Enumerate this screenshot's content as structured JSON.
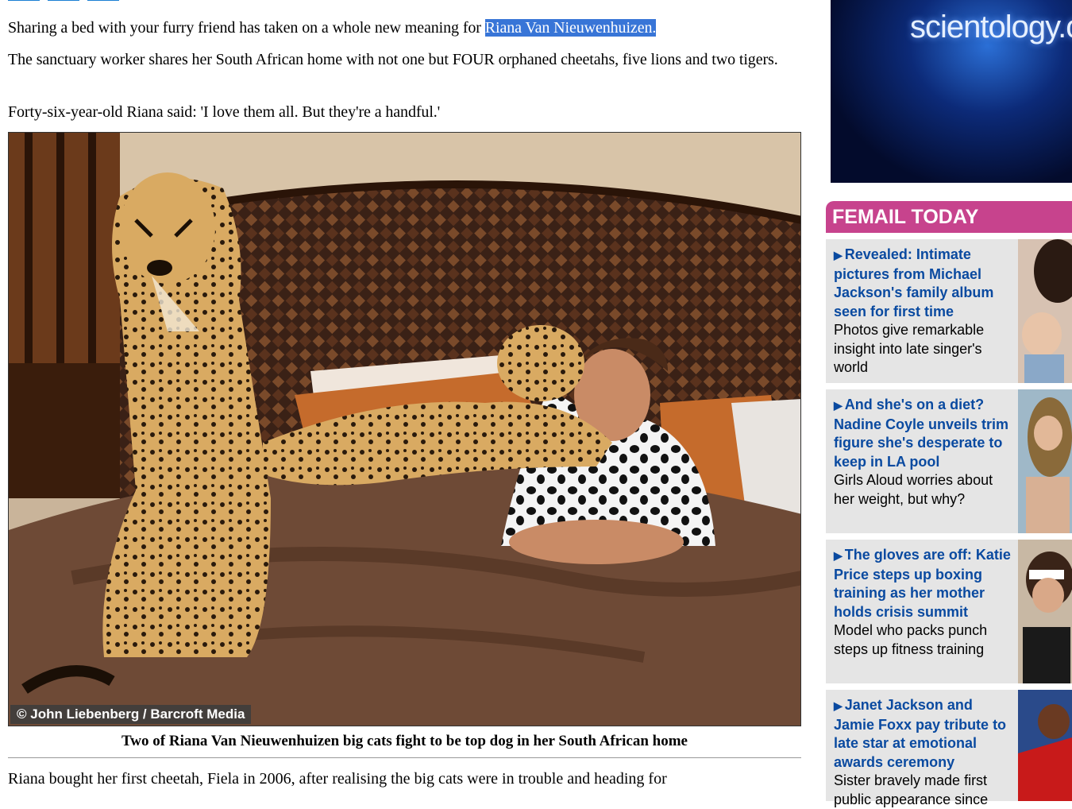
{
  "article": {
    "para1_prefix": "Sharing a bed with your furry friend has taken on a whole new meaning for ",
    "para1_highlight": "Riana Van Nieuwenhuizen.",
    "para2": "The sanctuary worker shares her South African home with not one but FOUR orphaned cheetahs, five lions and two tigers.",
    "para3": "Forty-six-year-old Riana said: 'I love them all. But they're a handful.'",
    "photo_credit": "© John Liebenberg / Barcroft Media",
    "caption": "Two of Riana Van Nieuwenhuizen big cats fight to be top dog in her South African home",
    "para4": "Riana bought her first cheetah, Fiela in 2006, after realising the big cats were in trouble and heading for"
  },
  "ad": {
    "text": "scientology.o"
  },
  "femail": {
    "title": "FEMAIL TODAY",
    "stories": [
      {
        "headline": "Revealed: Intimate pictures from Michael Jackson's family album seen for first time",
        "summary": "Photos give remarkable insight into late singer's world"
      },
      {
        "headline": "And she's on a diet? Nadine Coyle unveils trim figure she's desperate to keep in LA pool",
        "summary": "Girls Aloud worries about her weight, but why?"
      },
      {
        "headline": "The gloves are off: Katie Price steps up boxing training as her mother holds crisis summit",
        "summary": "Model who packs punch steps up fitness training"
      },
      {
        "headline": "Janet Jackson and Jamie Foxx pay tribute to late star at emotional awards ceremony",
        "summary": "Sister bravely made first public appearance since"
      }
    ]
  },
  "colors": {
    "femail_pink": "#c7438d",
    "link_blue": "#0a4aa0",
    "highlight": "#3875d7"
  },
  "icons": {
    "story_arrow": "play-arrow-icon"
  }
}
